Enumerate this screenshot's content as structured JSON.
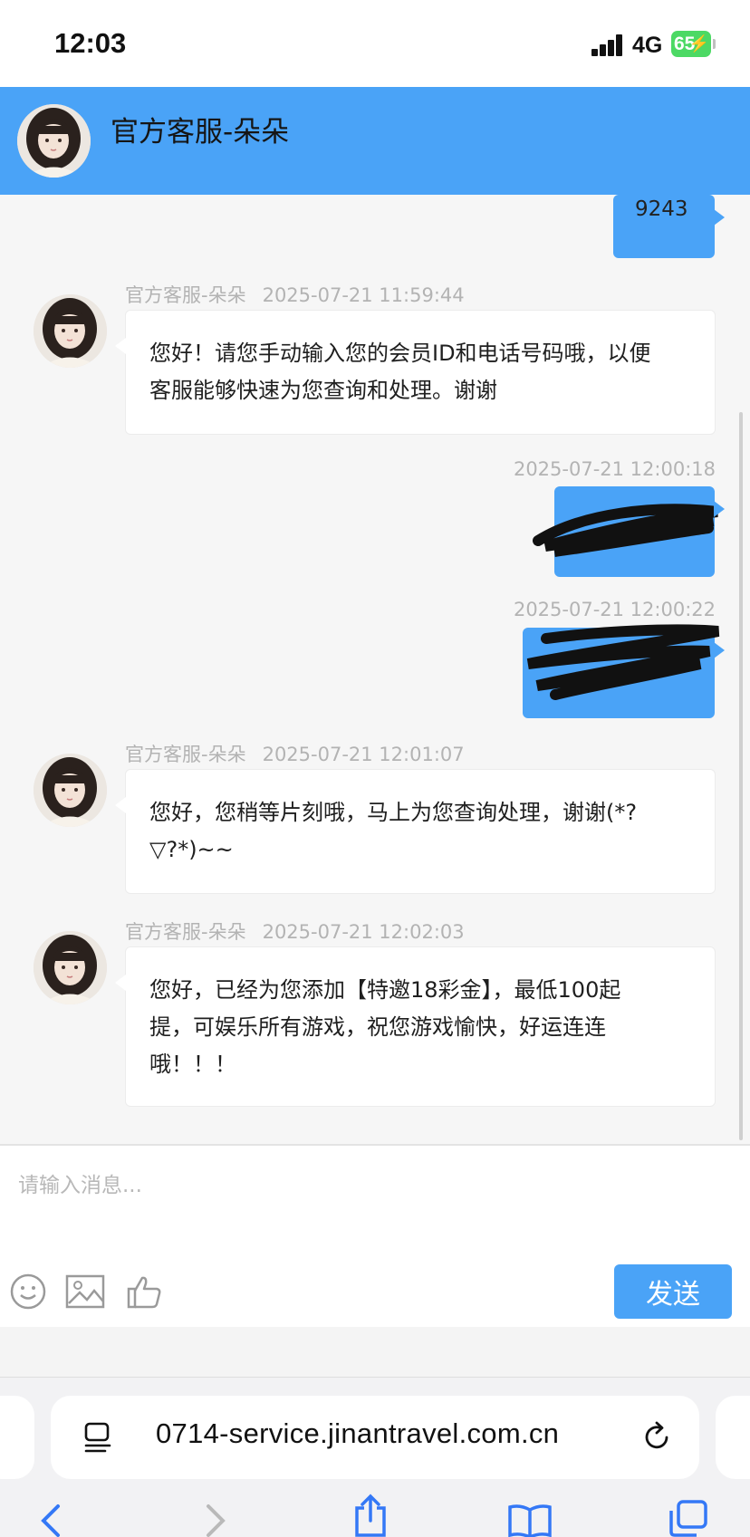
{
  "status_bar": {
    "time": "12:03",
    "network": "4G",
    "battery": "65"
  },
  "header": {
    "title": "官方客服-朵朵"
  },
  "messages": [
    {
      "direction": "out",
      "text": "9243"
    },
    {
      "direction": "in",
      "sender": "官方客服-朵朵",
      "timestamp": "2025-07-21 11:59:44",
      "lines": [
        "您好！请您手动输入您的会员ID和电话号码哦，以便",
        "客服能够快速为您查询和处理。谢谢"
      ]
    },
    {
      "direction": "out",
      "timestamp": "2025-07-21 12:00:18",
      "redacted": true
    },
    {
      "direction": "out",
      "timestamp": "2025-07-21 12:00:22",
      "redacted": true
    },
    {
      "direction": "in",
      "sender": "官方客服-朵朵",
      "timestamp": "2025-07-21 12:01:07",
      "lines": [
        "您好，您稍等片刻哦，马上为您查询处理，谢谢(*?",
        "▽?*)~~"
      ]
    },
    {
      "direction": "in",
      "sender": "官方客服-朵朵",
      "timestamp": "2025-07-21 12:02:03",
      "lines": [
        "您好，已经为您添加【特邀18彩金】，最低100起",
        "提，可娱乐所有游戏，祝您游戏愉快，好运连连",
        "哦！！！"
      ]
    }
  ],
  "input": {
    "placeholder": "请输入消息...",
    "value": ""
  },
  "toolbar": {
    "icons": [
      "smile-icon",
      "image-icon",
      "thumbs-up-icon"
    ],
    "send_label": "发送"
  },
  "browser": {
    "url": "0714-service.jinantravel.com.cn",
    "icons": [
      "tabs-icon",
      "reload-icon",
      "back-icon",
      "forward-icon",
      "share-icon",
      "bookmarks-icon",
      "tabs-overview-icon"
    ]
  },
  "colors": {
    "accent": "#4aa3f7",
    "battery": "#4cd964",
    "background": "#f6f6f6"
  }
}
